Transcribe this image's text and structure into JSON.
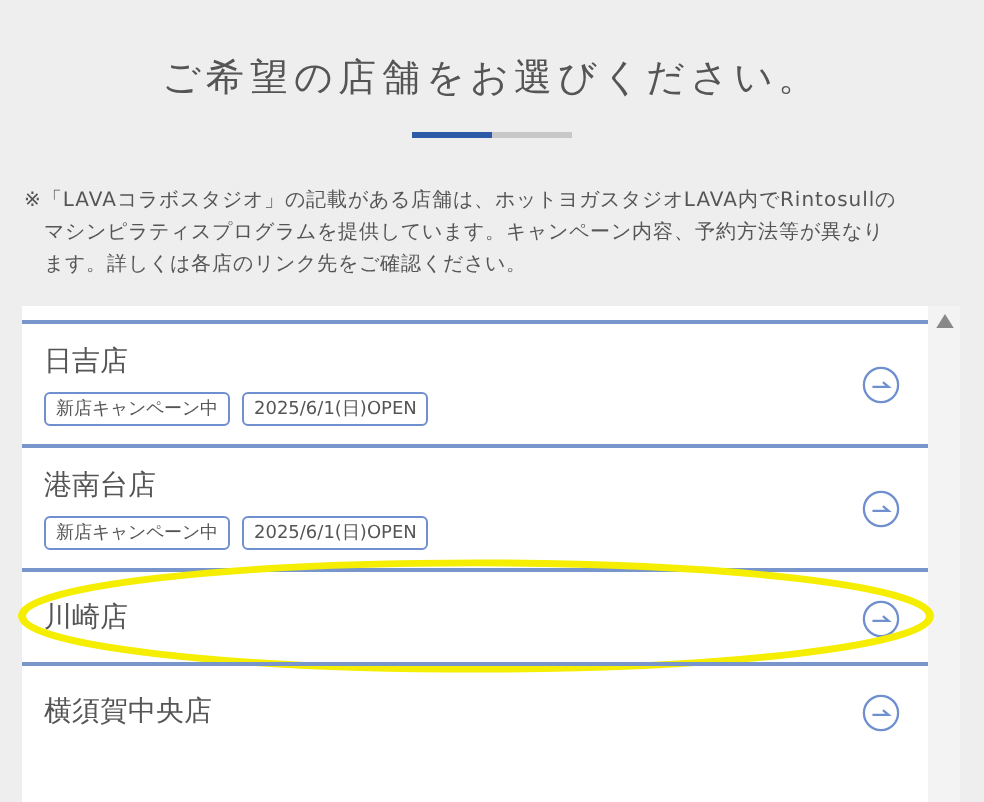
{
  "heading": "ご希望の店舗をお選びください。",
  "step_progress": {
    "level": 0.5
  },
  "note": "※「LAVAコラボスタジオ」の記載がある店舗は、ホットヨガスタジオLAVA内でRintosullのマシンピラティスプログラムを提供しています。キャンペーン内容、予約方法等が異なります。詳しくは各店のリンク先をご確認ください。",
  "stores": [
    {
      "name": "日吉店",
      "tags": [
        "新店キャンペーン中",
        "2025/6/1(日)OPEN"
      ],
      "highlighted": false
    },
    {
      "name": "港南台店",
      "tags": [
        "新店キャンペーン中",
        "2025/6/1(日)OPEN"
      ],
      "highlighted": false
    },
    {
      "name": "川崎店",
      "highlighted": true
    },
    {
      "name": "横須賀中央店",
      "highlighted": false
    }
  ]
}
